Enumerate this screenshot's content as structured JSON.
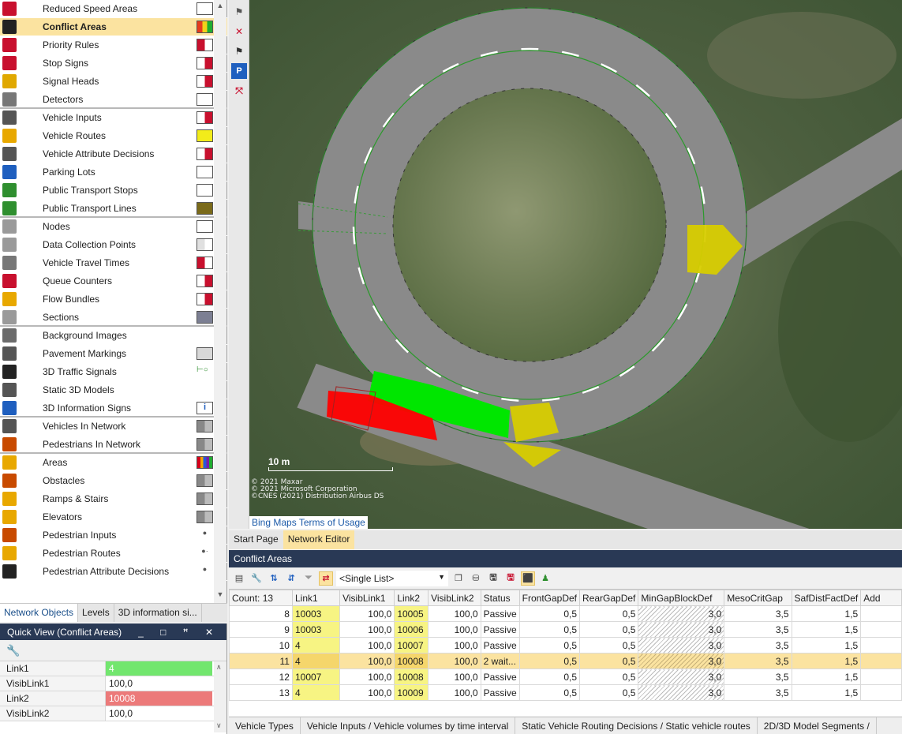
{
  "network_objects": [
    {
      "label": "Reduced Speed Areas",
      "icon": "reduced-speed-icon",
      "icon_color": "#c8102e",
      "swatch": [
        "#ffffff"
      ],
      "sep": false,
      "selected": false
    },
    {
      "label": "Conflict Areas",
      "icon": "conflict-areas-icon",
      "icon_color": "#222222",
      "swatch": [
        "#e63b1d",
        "#f2d21a",
        "#1fae2f"
      ],
      "sep": false,
      "selected": true
    },
    {
      "label": "Priority Rules",
      "icon": "priority-rule-icon",
      "icon_color": "#c8102e",
      "swatch": [
        "#c8102e",
        "#ffffff"
      ],
      "sep": false,
      "selected": false
    },
    {
      "label": "Stop Signs",
      "icon": "stop-sign-icon",
      "icon_color": "#c8102e",
      "swatch": [
        "#ffffff",
        "#c8102e"
      ],
      "sep": false,
      "selected": false
    },
    {
      "label": "Signal Heads",
      "icon": "signal-head-icon",
      "icon_color": "#e0a800",
      "swatch": [
        "#ffffff",
        "#c8102e"
      ],
      "sep": false,
      "selected": false
    },
    {
      "label": "Detectors",
      "icon": "detector-icon",
      "icon_color": "#777777",
      "swatch": [
        "#ffffff"
      ],
      "sep": true,
      "selected": false
    },
    {
      "label": "Vehicle Inputs",
      "icon": "vehicle-input-icon",
      "icon_color": "#555555",
      "swatch": [
        "#ffffff",
        "#c8102e"
      ],
      "sep": false,
      "selected": false
    },
    {
      "label": "Vehicle Routes",
      "icon": "vehicle-route-icon",
      "icon_color": "#e8a800",
      "swatch": [
        "#f2ec1a"
      ],
      "sep": false,
      "selected": false
    },
    {
      "label": "Vehicle Attribute Decisions",
      "icon": "vehicle-attribute-icon",
      "icon_color": "#555555",
      "swatch": [
        "#ffffff",
        "#c8102e"
      ],
      "sep": false,
      "selected": false
    },
    {
      "label": "Parking Lots",
      "icon": "parking-icon",
      "icon_color": "#1f5fbf",
      "swatch": [
        "#ffffff"
      ],
      "sep": false,
      "selected": false
    },
    {
      "label": "Public Transport Stops",
      "icon": "pt-stop-icon",
      "icon_color": "#2f8f2f",
      "swatch": [
        "#ffffff"
      ],
      "sep": false,
      "selected": false
    },
    {
      "label": "Public Transport Lines",
      "icon": "pt-line-icon",
      "icon_color": "#2f8f2f",
      "swatch": [
        "#7a6a1a"
      ],
      "sep": true,
      "selected": false
    },
    {
      "label": "Nodes",
      "icon": "node-icon",
      "icon_color": "#9a9a9a",
      "swatch": [
        "#ffffff"
      ],
      "sep": false,
      "selected": false
    },
    {
      "label": "Data Collection Points",
      "icon": "data-collection-icon",
      "icon_color": "#9a9a9a",
      "swatch": [
        "#e0e0e0",
        "#ffffff"
      ],
      "sep": false,
      "selected": false
    },
    {
      "label": "Vehicle Travel Times",
      "icon": "travel-time-icon",
      "icon_color": "#777777",
      "swatch": [
        "#c8102e",
        "#ffffff"
      ],
      "sep": false,
      "selected": false
    },
    {
      "label": "Queue Counters",
      "icon": "queue-counter-icon",
      "icon_color": "#c8102e",
      "swatch": [
        "#ffffff",
        "#c8102e"
      ],
      "sep": false,
      "selected": false
    },
    {
      "label": "Flow Bundles",
      "icon": "flow-bundle-icon",
      "icon_color": "#e8a800",
      "swatch": [
        "#ffffff",
        "#c8102e"
      ],
      "sep": false,
      "selected": false
    },
    {
      "label": "Sections",
      "icon": "section-icon",
      "icon_color": "#9a9a9a",
      "swatch": [
        "#7c7f93"
      ],
      "sep": true,
      "selected": false
    },
    {
      "label": "Background Images",
      "icon": "background-image-icon",
      "icon_color": "#6b6b6b",
      "swatch": [],
      "sep": false,
      "selected": false
    },
    {
      "label": "Pavement Markings",
      "icon": "pavement-marking-icon",
      "icon_color": "#555555",
      "swatch": [
        "#d8d8d8"
      ],
      "sep": false,
      "selected": false
    },
    {
      "label": "3D Traffic Signals",
      "icon": "traffic-signal-3d-icon",
      "icon_color": "#222222",
      "swatch": [
        "signal"
      ],
      "sep": false,
      "selected": false
    },
    {
      "label": "Static 3D Models",
      "icon": "static-model-icon",
      "icon_color": "#555555",
      "swatch": [],
      "sep": false,
      "selected": false
    },
    {
      "label": "3D Information Signs",
      "icon": "info-sign-icon",
      "icon_color": "#1f5fbf",
      "swatch": [
        "info"
      ],
      "sep": true,
      "selected": false
    },
    {
      "label": "Vehicles In Network",
      "icon": "vehicle-network-icon",
      "icon_color": "#555555",
      "swatch": [
        "#888888",
        "#bbbbbb"
      ],
      "sep": false,
      "selected": false
    },
    {
      "label": "Pedestrians In Network",
      "icon": "pedestrian-network-icon",
      "icon_color": "#c84a00",
      "swatch": [
        "#888888",
        "#bbbbbb"
      ],
      "sep": true,
      "selected": false
    },
    {
      "label": "Areas",
      "icon": "area-icon",
      "icon_color": "#e8a800",
      "swatch": [
        "#d8001a",
        "#f2a800",
        "#2a58d8",
        "#7a1aa8",
        "#1fae2f"
      ],
      "sep": false,
      "selected": false
    },
    {
      "label": "Obstacles",
      "icon": "obstacle-icon",
      "icon_color": "#c84a00",
      "swatch": [
        "#888888",
        "#bbbbbb"
      ],
      "sep": false,
      "selected": false
    },
    {
      "label": "Ramps & Stairs",
      "icon": "ramp-stairs-icon",
      "icon_color": "#e8a800",
      "swatch": [
        "#888888",
        "#bbbbbb"
      ],
      "sep": false,
      "selected": false
    },
    {
      "label": "Elevators",
      "icon": "elevator-icon",
      "icon_color": "#e8a800",
      "swatch": [
        "#888888",
        "#bbbbbb"
      ],
      "sep": false,
      "selected": false
    },
    {
      "label": "Pedestrian Inputs",
      "icon": "pedestrian-input-icon",
      "icon_color": "#c84a00",
      "swatch": [
        "dot"
      ],
      "sep": false,
      "selected": false
    },
    {
      "label": "Pedestrian Routes",
      "icon": "pedestrian-route-icon",
      "icon_color": "#e8a800",
      "swatch": [
        "dots"
      ],
      "sep": false,
      "selected": false
    },
    {
      "label": "Pedestrian Attribute Decisions",
      "icon": "pedestrian-attribute-icon",
      "icon_color": "#222222",
      "swatch": [
        "dot"
      ],
      "sep": false,
      "selected": false
    }
  ],
  "left_tabs": [
    "Network Objects",
    "Levels",
    "3D information si..."
  ],
  "quick_view": {
    "title": "Quick View (Conflict Areas)",
    "window_buttons": "_ □ ꟸ ✕",
    "rows": [
      {
        "key": "Link1",
        "value": "4",
        "style": "green"
      },
      {
        "key": "VisibLink1",
        "value": "100,0",
        "style": ""
      },
      {
        "key": "Link2",
        "value": "10008",
        "style": "red"
      },
      {
        "key": "VisibLink2",
        "value": "100,0",
        "style": ""
      }
    ]
  },
  "map": {
    "scale_label": "10 m",
    "copyright_lines": [
      "© 2021 Maxar",
      "© 2021 Microsoft Corporation",
      "©CNES (2021) Distribution Airbus DS"
    ],
    "bing_link": "Bing Maps Terms of Usage"
  },
  "doc_tabs": [
    "Start Page",
    "Network Editor"
  ],
  "conflict_list": {
    "title": "Conflict Areas",
    "list_selector": "<Single List>",
    "columns": [
      "Count: 13",
      "Link1",
      "VisibLink1",
      "Link2",
      "VisibLink2",
      "Status",
      "FrontGapDef",
      "RearGapDef",
      "MinGapBlockDef",
      "MesoCritGap",
      "SafDistFactDef",
      "Add"
    ],
    "rows": [
      {
        "no": "8",
        "link1": "10003",
        "vis1": "100,0",
        "link2": "10005",
        "vis2": "100,0",
        "status": "Passive",
        "front": "0,5",
        "rear": "0,5",
        "mingap": "3,0",
        "meso": "3,5",
        "saf": "1,5",
        "highlight": false
      },
      {
        "no": "9",
        "link1": "10003",
        "vis1": "100,0",
        "link2": "10006",
        "vis2": "100,0",
        "status": "Passive",
        "front": "0,5",
        "rear": "0,5",
        "mingap": "3,0",
        "meso": "3,5",
        "saf": "1,5",
        "highlight": false
      },
      {
        "no": "10",
        "link1": "4",
        "vis1": "100,0",
        "link2": "10007",
        "vis2": "100,0",
        "status": "Passive",
        "front": "0,5",
        "rear": "0,5",
        "mingap": "3,0",
        "meso": "3,5",
        "saf": "1,5",
        "highlight": false
      },
      {
        "no": "11",
        "link1": "4",
        "vis1": "100,0",
        "link2": "10008",
        "vis2": "100,0",
        "status": "2 wait...",
        "front": "0,5",
        "rear": "0,5",
        "mingap": "3,0",
        "meso": "3,5",
        "saf": "1,5",
        "highlight": true
      },
      {
        "no": "12",
        "link1": "10007",
        "vis1": "100,0",
        "link2": "10008",
        "vis2": "100,0",
        "status": "Passive",
        "front": "0,5",
        "rear": "0,5",
        "mingap": "3,0",
        "meso": "3,5",
        "saf": "1,5",
        "highlight": false
      },
      {
        "no": "13",
        "link1": "4",
        "vis1": "100,0",
        "link2": "10009",
        "vis2": "100,0",
        "status": "Passive",
        "front": "0,5",
        "rear": "0,5",
        "mingap": "3,0",
        "meso": "3,5",
        "saf": "1,5",
        "highlight": false
      }
    ]
  },
  "bottom_tabs": [
    "Vehicle Types",
    "Vehicle Inputs / Vehicle volumes by time interval",
    "Static Vehicle Routing Decisions / Static vehicle routes",
    "2D/3D Model Segments /"
  ]
}
